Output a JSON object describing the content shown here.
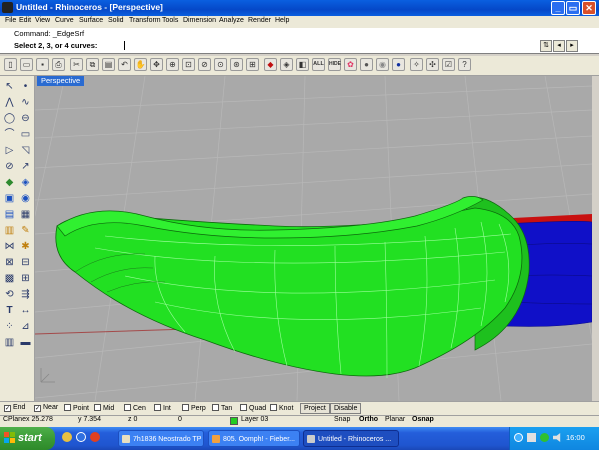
{
  "window": {
    "title": "Untitled - Rhinoceros - [Perspective]",
    "minimize": "_",
    "maximize": "▭",
    "close": "✕"
  },
  "menu": [
    "File",
    "Edit",
    "View",
    "Curve",
    "Surface",
    "Solid",
    "Transform",
    "Tools",
    "Dimension",
    "Analyze",
    "Render",
    "Help"
  ],
  "command": {
    "history": "Command: _EdgeSrf",
    "prompt": "Select 2, 3, or 4 curves:"
  },
  "toolbar": {
    "icons": [
      "new-icon",
      "open-icon",
      "save-icon",
      "print-icon",
      "cut-icon",
      "copy-icon",
      "paste-icon",
      "undo-icon",
      "pan-icon",
      "rotate-view-icon",
      "zoom-icon",
      "zoom-window-icon",
      "zoom-extents-icon",
      "zoom-selected-icon",
      "four-viewports-icon",
      "car-icon",
      "render-icon",
      "show-all-icon",
      "hide-icon",
      "color-wheel-icon",
      "material-icon",
      "globe-icon",
      "light-icon",
      "settings-icon",
      "properties-icon",
      "help-icon"
    ],
    "all_label": "ALL",
    "hide_label": "HIDE"
  },
  "viewport": {
    "label": "Perspective",
    "surface_color": "#22e022",
    "cylinder_color": "#1010c8",
    "axis_x_color": "#c81010"
  },
  "osnap": {
    "items": [
      {
        "label": "End",
        "checked": true
      },
      {
        "label": "Near",
        "checked": true
      },
      {
        "label": "Point",
        "checked": false
      },
      {
        "label": "Mid",
        "checked": false
      },
      {
        "label": "Cen",
        "checked": false
      },
      {
        "label": "Int",
        "checked": false
      },
      {
        "label": "Perp",
        "checked": false
      },
      {
        "label": "Tan",
        "checked": false
      },
      {
        "label": "Quad",
        "checked": false
      },
      {
        "label": "Knot",
        "checked": false
      }
    ],
    "project": "Project",
    "disable": "Disable"
  },
  "status": {
    "cplane": "CPlane",
    "x": "x 25.278",
    "y": "y 7.354",
    "z": "z 0",
    "zval": "0",
    "layer": "Layer 03",
    "layer_color": "#22cc22",
    "snap": "Snap",
    "ortho": "Ortho",
    "planar": "Planar",
    "osnap": "Osnap"
  },
  "taskbar": {
    "start": "start",
    "tasks": [
      "7h1836 Neostrado TP",
      "805. Oomph! - Fieber...",
      "Untitled - Rhinoceros ..."
    ],
    "clock": "16:00"
  }
}
